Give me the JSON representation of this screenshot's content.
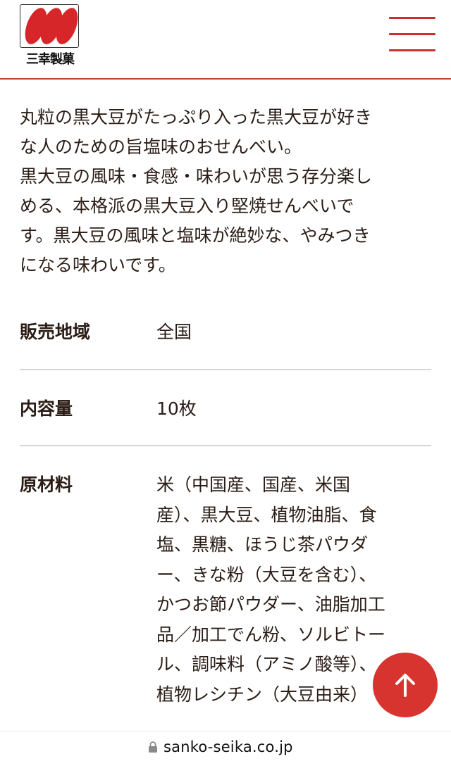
{
  "header": {
    "logo_text": "三幸製菓"
  },
  "description": {
    "lines": [
      "丸粒の黒大豆がたっぷり入った黒大豆が好き",
      "な人のための旨塩味のおせんべい。",
      "黒大豆の風味・食感・味わいが思う存分楽し",
      "める、本格派の黒大豆入り堅焼せんべいで",
      "す。黒大豆の風味と塩味が絶妙な、やみつき",
      "になる味わいです。"
    ]
  },
  "specs": {
    "region": {
      "label": "販売地域",
      "value": "全国"
    },
    "quantity": {
      "label": "内容量",
      "value": "10枚"
    },
    "ingredients": {
      "label": "原材料",
      "lines": [
        "米（中国産、国産、米国",
        "産）、黒大豆、植物油脂、食",
        "塩、黒糖、ほうじ茶パウダ",
        "ー、きな粉（大豆を含む）、",
        "かつお節パウダー、油脂加工",
        "品／加工でん粉、ソルビトー",
        "ル、調味料（アミノ酸等）、",
        "植物レシチン（大豆由来）"
      ]
    }
  },
  "browser": {
    "url": "sanko-seika.co.jp"
  },
  "colors": {
    "accent": "#d7342f",
    "header_rule": "#c64334",
    "text": "#2b1d16",
    "divider": "#d6d6d6"
  },
  "icons": {
    "menu": "hamburger-icon",
    "back_to_top": "arrow-up-icon",
    "lock": "lock-icon"
  }
}
